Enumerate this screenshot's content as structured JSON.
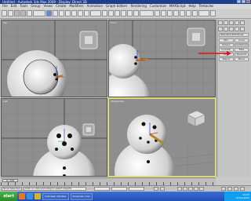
{
  "window": {
    "title": "Untitled - Autodesk 3ds Max 2009 - Display: Direct 3D",
    "close_label": "x"
  },
  "menubar": [
    "File",
    "Edit",
    "Tools",
    "Group",
    "Views",
    "Create",
    "Modifiers",
    "Animation",
    "Graph Editors",
    "Rendering",
    "Customize",
    "MAXScript",
    "Help",
    "Tentacles"
  ],
  "viewports": {
    "top": "Top",
    "front": "Front",
    "left": "Left",
    "perspective": "Perspective"
  },
  "command_panel": {
    "object_name": "Standard Primitives",
    "buttons": [
      "Box",
      "Cone",
      "Sphere",
      "GeoSphere",
      "Cylinder",
      "Tube",
      "Torus",
      "Pyramid",
      "Teapot",
      "Plane"
    ]
  },
  "timeline": {
    "slider": "0 / 100"
  },
  "status": {
    "selection": "None Selected",
    "prompt": "Click or click-and-drag to select objects"
  },
  "taskbar": {
    "start": "start",
    "items": [
      "Autodesk 3ds Max",
      "Snowman.max"
    ],
    "time": "10:05",
    "date": "07/01/2009"
  },
  "colors": {
    "viewport_bg": "#8e8e8e",
    "active_border": "#e8e82c",
    "accent": "#1d3f8e"
  }
}
